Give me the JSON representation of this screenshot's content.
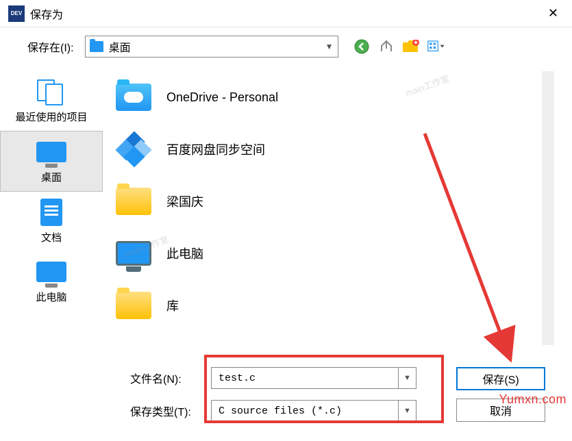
{
  "title": "保存为",
  "location": {
    "label": "保存在(I):",
    "value": "桌面"
  },
  "sidebar": {
    "items": [
      {
        "label": "最近使用的项目"
      },
      {
        "label": "桌面"
      },
      {
        "label": "文档"
      },
      {
        "label": "此电脑"
      }
    ]
  },
  "files": [
    {
      "name": "OneDrive - Personal"
    },
    {
      "name": "百度网盘同步空间"
    },
    {
      "name": "梁国庆"
    },
    {
      "name": "此电脑"
    },
    {
      "name": "库"
    }
  ],
  "fields": {
    "filename_label": "文件名(N):",
    "filename_value": "test.c",
    "filetype_label": "保存类型(T):",
    "filetype_value": "C source files (*.c)"
  },
  "buttons": {
    "save": "保存(S)",
    "cancel": "取消"
  },
  "watermarks": {
    "studio": "main工作室",
    "corner": "Yumxn.com"
  }
}
